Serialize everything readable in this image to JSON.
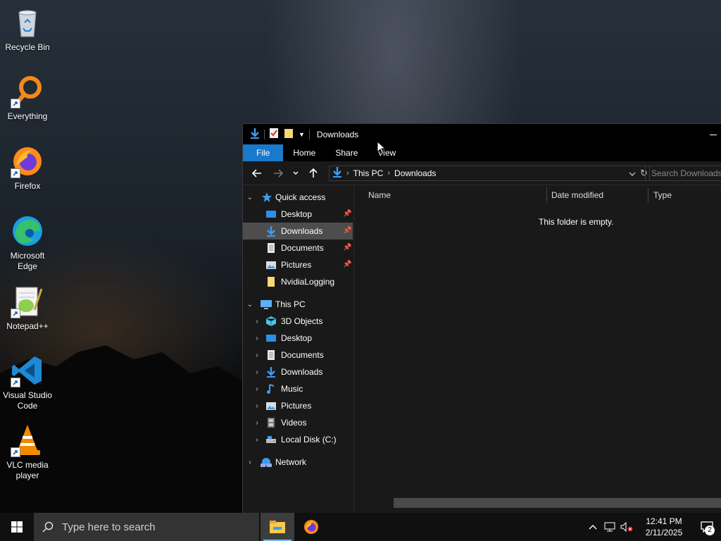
{
  "desktop": {
    "icons": [
      {
        "label": "Recycle Bin",
        "icon": "recycle-bin-icon"
      },
      {
        "label": "Everything",
        "icon": "everything-search-icon"
      },
      {
        "label": "Firefox",
        "icon": "firefox-icon"
      },
      {
        "label": "Microsoft Edge",
        "icon": "edge-icon"
      },
      {
        "label": "Notepad++",
        "icon": "notepadpp-icon"
      },
      {
        "label": "Visual Studio Code",
        "icon": "vscode-icon"
      },
      {
        "label": "VLC media player",
        "icon": "vlc-icon"
      }
    ]
  },
  "explorer": {
    "title": "Downloads",
    "ribbon_tabs": [
      "File",
      "Home",
      "Share",
      "View"
    ],
    "breadcrumb": [
      "This PC",
      "Downloads"
    ],
    "search_placeholder": "Search Downloads",
    "nav": {
      "quick_access": "Quick access",
      "quick_items": [
        "Desktop",
        "Downloads",
        "Documents",
        "Pictures",
        "NvidiaLogging"
      ],
      "this_pc": "This PC",
      "pc_items": [
        "3D Objects",
        "Desktop",
        "Documents",
        "Downloads",
        "Music",
        "Pictures",
        "Videos",
        "Local Disk (C:)"
      ],
      "network": "Network"
    },
    "columns": [
      "Name",
      "Date modified",
      "Type"
    ],
    "empty_message": "This folder is empty."
  },
  "taskbar": {
    "search_placeholder": "Type here to search",
    "time": "12:41 PM",
    "date": "2/11/2025",
    "notification_count": "2"
  },
  "colors": {
    "accent": "#1979ca",
    "selection": "#4d4d4d",
    "window_bg": "#191919",
    "taskbar_bg": "#101010"
  }
}
